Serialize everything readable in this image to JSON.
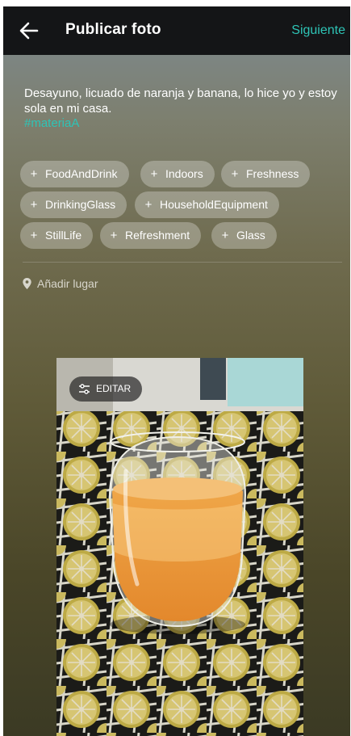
{
  "header": {
    "title": "Publicar foto",
    "next_label": "Siguiente"
  },
  "post": {
    "caption": "Desayuno, licuado de naranja y banana, lo hice yo y estoy sola en mi casa.",
    "hashtag": "#materiaA"
  },
  "tags": [
    {
      "label": "FoodAndDrink"
    },
    {
      "label": "Indoors"
    },
    {
      "label": "Freshness"
    },
    {
      "label": "DrinkingGlass"
    },
    {
      "label": "HouseholdEquipment"
    },
    {
      "label": "StillLife"
    },
    {
      "label": "Refreshment"
    },
    {
      "label": "Glass"
    }
  ],
  "chip_plus_symbol": "+",
  "location": {
    "label": "Añadir lugar"
  },
  "photo": {
    "edit_label": "EDITAR"
  },
  "colors": {
    "accent": "#2ec4b6",
    "topbar": "#141517"
  },
  "icons": {
    "back": "arrow-left-icon",
    "location": "map-pin-icon",
    "edit": "sliders-icon"
  }
}
